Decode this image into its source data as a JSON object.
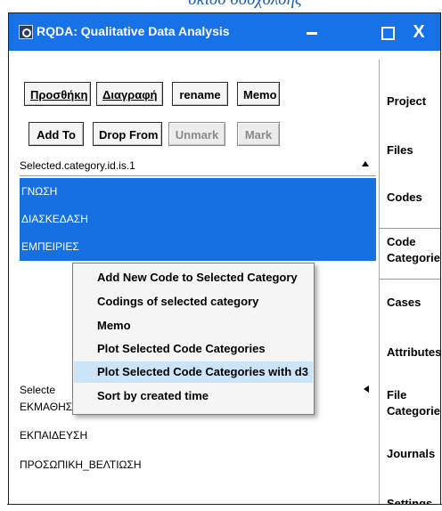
{
  "above_text": "σκισσ σσσχσλσης",
  "window": {
    "title": "RQDA: Qualitative Data Analysis",
    "controls": [
      "–",
      "□",
      "X"
    ]
  },
  "toolbar": {
    "row1": [
      "Προσθήκη",
      "Διαγραφή",
      "rename",
      "Memo"
    ],
    "row2": [
      "Add To",
      "Drop From",
      "Unmark",
      "Mark"
    ]
  },
  "top_list": {
    "header": "Selected.category.id.is.1",
    "items": [
      "ΓΝΩΣΗ",
      "ΔΙΑΣΚΕΔΑΣΗ",
      "ΕΜΠΕΙΡΙΕΣ"
    ]
  },
  "bottom_list": {
    "header": "Selecte",
    "items": [
      "ΕΚΜΑΘΗΣΗ_ΓΛΩΣΣΑΣ",
      "ΕΚΠΑΙΔΕΥΣΗ",
      "ΠΡΟΣΩΠΙΚΗ_ΒΕΛΤΙΩΣΗ"
    ]
  },
  "context_menu": {
    "items": [
      "Add New Code to Selected Category",
      "Codings of selected category",
      "Memo",
      "Plot Selected Code Categories",
      "Plot Selected Code Categories with d3",
      "Sort by created time"
    ]
  },
  "tabs": [
    "Project",
    "Files",
    "Codes",
    "Code\nCategories",
    "Cases",
    "Attributes",
    "File\nCategories",
    "Journals",
    "Settings"
  ],
  "colors": {
    "titlebar": "#1672e6",
    "selection": "#1670e0",
    "menu_highlight": "#cce4f7"
  }
}
